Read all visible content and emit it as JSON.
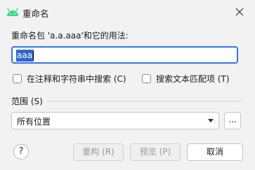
{
  "window": {
    "title": "重命名",
    "icon": "android-icon",
    "close_icon": "close-icon"
  },
  "description": "重命名包 'a.a.aaa'和它的用法:",
  "name_field": {
    "value": "aaa"
  },
  "options": {
    "search_comments": "在注释和字符串中搜索 (C)",
    "search_text": "搜索文本匹配项 (T)"
  },
  "scope": {
    "title": "范围 (S)",
    "selected": "所有位置",
    "more_label": "..."
  },
  "buttons": {
    "help": "?",
    "refactor": "重构 (R)",
    "preview": "预览 (P)",
    "cancel": "取消"
  },
  "colors": {
    "accent": "#3574f0",
    "selection": "#2f65ca",
    "android_green": "#3ddc84"
  }
}
